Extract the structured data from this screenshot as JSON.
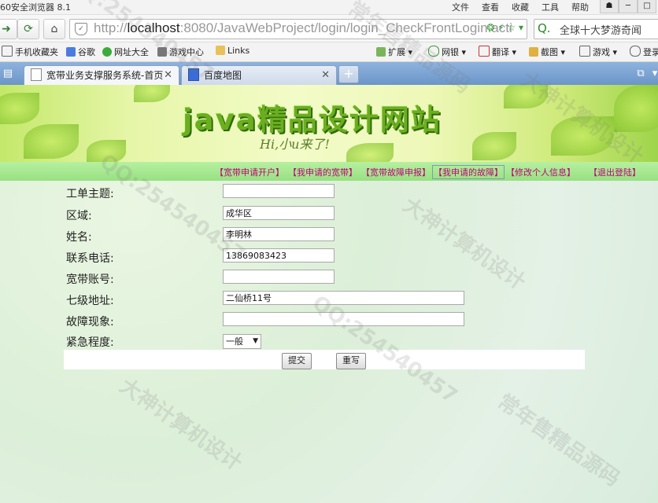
{
  "browser": {
    "app_name": "60安全浏览器 8.1",
    "menu": [
      "文件",
      "查看",
      "收藏",
      "工具",
      "帮助"
    ],
    "url_prefix": "http://",
    "url_host": "localhost",
    "url_rest": ":8080/JavaWebProject/login/login_CheckFrontLogin.acti",
    "search_text": "全球十大梦游奇闻",
    "bookmarks": [
      "手机收藏夹",
      "谷歌",
      "网址大全",
      "游戏中心",
      "Links"
    ],
    "toolbar_right": [
      "扩展",
      "网银",
      "翻译",
      "截图",
      "游戏",
      "登录"
    ],
    "tabs": [
      {
        "label": "宽带业务支撑服务系统-首页",
        "active": true
      },
      {
        "label": "百度地图",
        "active": false
      }
    ]
  },
  "header": {
    "title": "java精品设计网站",
    "subtitle": "Hi,小u来了!"
  },
  "nav": [
    "【宽带申请开户】",
    "【我申请的宽带】",
    "【宽带故障申报】",
    "【我申请的故障】",
    "【修改个人信息】",
    "【退出登陆】"
  ],
  "form": {
    "fields": [
      {
        "label": "工单主题:",
        "value": ""
      },
      {
        "label": "区域:",
        "value": "成华区"
      },
      {
        "label": "姓名:",
        "value": "李明林"
      },
      {
        "label": "联系电话:",
        "value": "13869083423"
      },
      {
        "label": "宽带账号:",
        "value": ""
      },
      {
        "label": "七级地址:",
        "value": "二仙桥11号"
      },
      {
        "label": "故障现象:",
        "value": ""
      }
    ],
    "urgency_label": "紧急程度:",
    "urgency_value": "一般",
    "submit_label": "提交",
    "reset_label": "重写"
  },
  "watermarks": [
    "QQ:254540457",
    "大神计算机设计",
    "常年售精品源码"
  ]
}
